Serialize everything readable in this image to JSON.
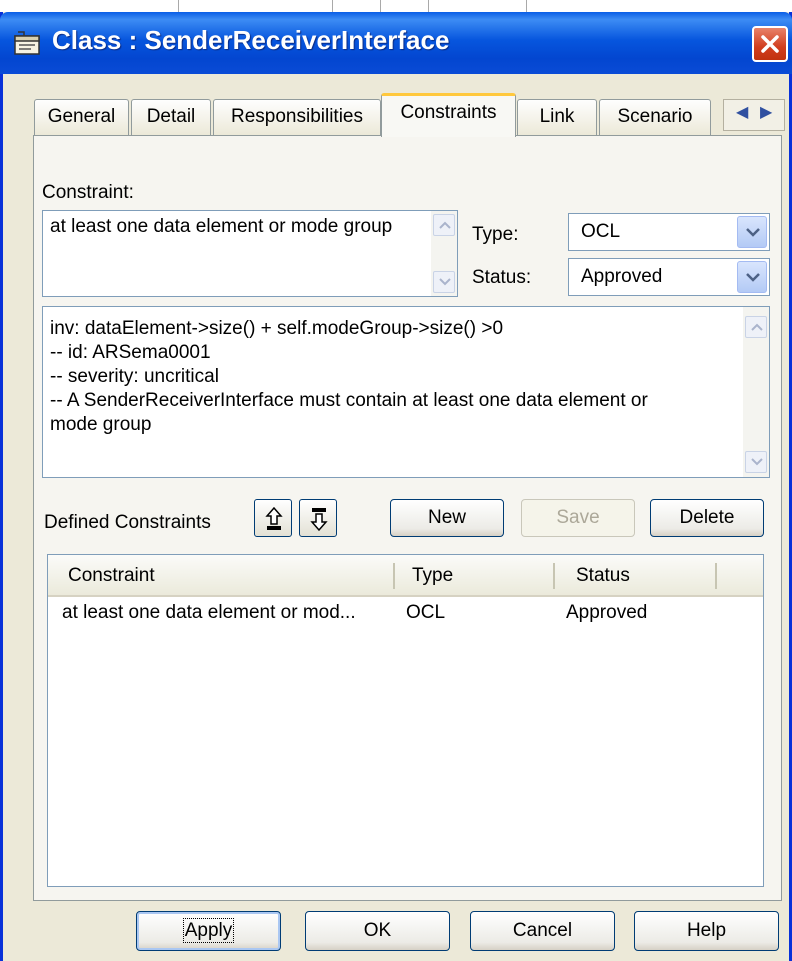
{
  "window": {
    "title": "Class : SenderReceiverInterface"
  },
  "tabs": [
    {
      "label": "General",
      "active": false
    },
    {
      "label": "Detail",
      "active": false
    },
    {
      "label": "Responsibilities",
      "active": false
    },
    {
      "label": "Constraints",
      "active": true
    },
    {
      "label": "Link",
      "active": false
    },
    {
      "label": "Scenario",
      "active": false
    }
  ],
  "constraint_form": {
    "constraint_label": "Constraint:",
    "constraint_text": "at least one data element or mode group",
    "type_label": "Type:",
    "type_value": "OCL",
    "status_label": "Status:",
    "status_value": "Approved",
    "notes_lines": [
      "inv: dataElement->size() + self.modeGroup->size() >0",
      "-- id: ARSema0001",
      "-- severity: uncritical",
      "-- A SenderReceiverInterface must contain at least one data element or",
      "mode group"
    ]
  },
  "defined": {
    "label": "Defined Constraints",
    "new_label": "New",
    "save_label": "Save",
    "delete_label": "Delete",
    "columns": [
      "Constraint",
      "Type",
      "Status"
    ],
    "rows": [
      {
        "constraint": "at least one data element or mod...",
        "type": "OCL",
        "status": "Approved"
      }
    ]
  },
  "buttons": {
    "apply": "Apply",
    "ok": "OK",
    "cancel": "Cancel",
    "help": "Help"
  },
  "icons": {
    "window": "class-properties-icon",
    "close": "close-icon",
    "move_up": "move-up-icon",
    "move_down": "move-down-icon"
  },
  "colors": {
    "titlebar": "#0754dc",
    "active_tab_highlight": "#ffc83c",
    "close_button": "#d13d1e"
  }
}
